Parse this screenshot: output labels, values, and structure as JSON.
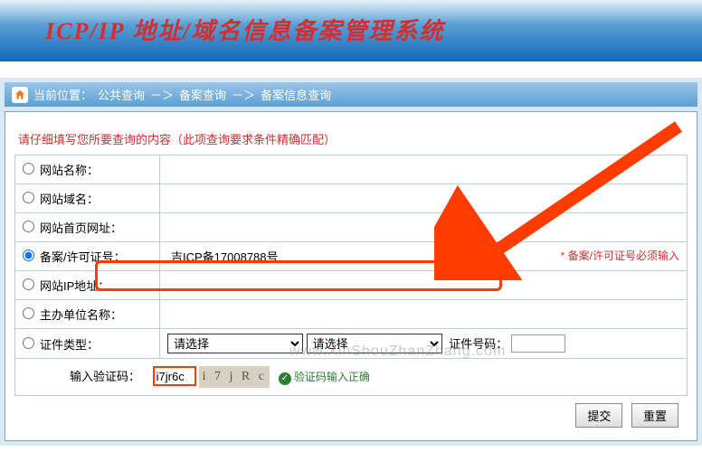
{
  "header": {
    "title": "ICP/IP 地址/域名信息备案管理系统"
  },
  "breadcrumb": {
    "label": "当前位置：",
    "p1": "公共查询",
    "sep": "－＞",
    "p2": "备案查询",
    "p3": "备案信息查询"
  },
  "instruction": "请仔细填写您所要查询的内容（此项查询要求条件精确匹配）",
  "rows": {
    "site_name": "网站名称：",
    "site_domain": "网站域名：",
    "site_home": "网站首页网址：",
    "license_no": "备案/许可证号：",
    "ip_addr": "网站IP地址：",
    "sponsor": "主办单位名称：",
    "cert_type": "证件类型：",
    "cert_no_label": "证件号码："
  },
  "values": {
    "license_no": "吉ICP备17008788号",
    "select_placeholder": "请选择",
    "captcha_input": "i7jr6c",
    "captcha_text": "i 7 j R c"
  },
  "req_note": "* 备案/许可证号必须输入",
  "captcha": {
    "label": "输入验证码：",
    "ok": "验证码输入正确"
  },
  "buttons": {
    "submit": "提交",
    "reset": "重置"
  },
  "watermark": "www.XinShouZhanZhang.com"
}
